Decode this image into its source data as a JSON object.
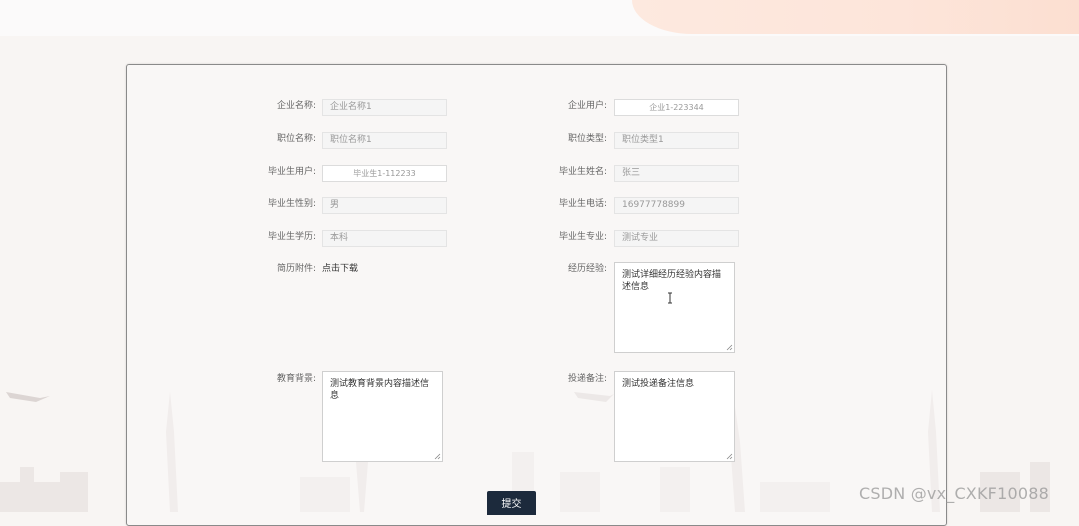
{
  "form": {
    "company_name_label": "企业名称:",
    "company_name_value": "企业名称1",
    "company_user_label": "企业用户:",
    "company_user_value": "企业1-223344",
    "position_name_label": "职位名称:",
    "position_name_value": "职位名称1",
    "position_type_label": "职位类型:",
    "position_type_value": "职位类型1",
    "graduate_user_label": "毕业生用户:",
    "graduate_user_value": "毕业生1-112233",
    "graduate_name_label": "毕业生姓名:",
    "graduate_name_value": "张三",
    "graduate_gender_label": "毕业生性别:",
    "graduate_gender_value": "男",
    "graduate_phone_label": "毕业生电话:",
    "graduate_phone_value": "16977778899",
    "graduate_education_label": "毕业生学历:",
    "graduate_education_value": "本科",
    "graduate_major_label": "毕业生专业:",
    "graduate_major_value": "测试专业",
    "resume_attachment_label": "简历附件:",
    "resume_download_link": "点击下载",
    "experience_label": "经历经验:",
    "experience_value": "测试详细经历经验内容描述信息",
    "education_background_label": "教育背景:",
    "education_background_value": "测试教育背景内容描述信息",
    "delivery_note_label": "投递备注:",
    "delivery_note_value": "测试投递备注信息",
    "submit_label": "提交"
  },
  "watermark": "CSDN @vx_CXKF10088",
  "colors": {
    "submit_bg": "#1c2a3c",
    "page_bg": "#f8f5f3",
    "top_accent": "#fde5da"
  },
  "icons": {
    "text_cursor": "text-cursor-icon",
    "resize_grip": "resize-grip-icon"
  }
}
